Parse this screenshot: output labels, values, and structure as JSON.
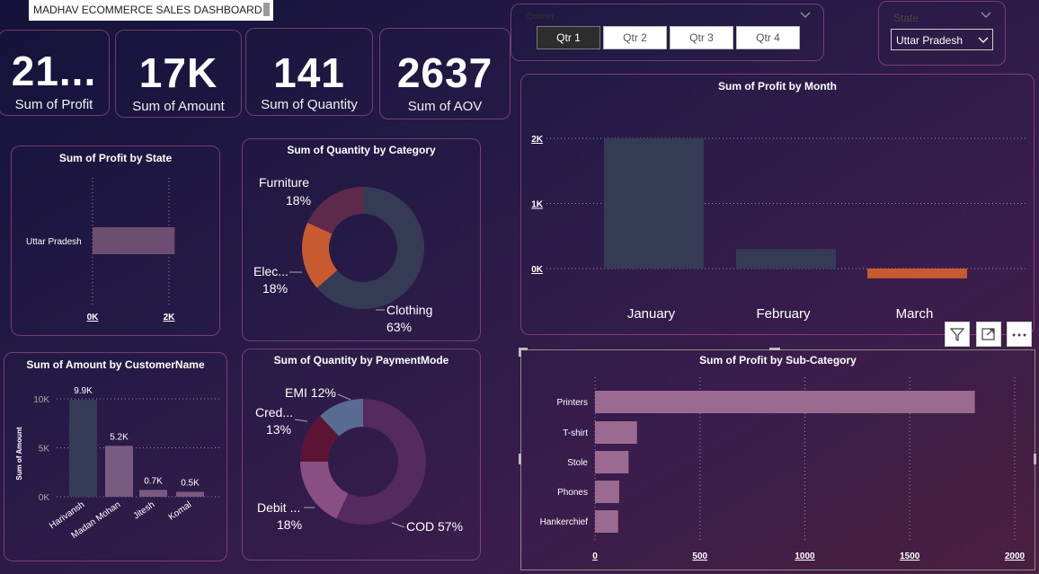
{
  "dashboard_title": "MADHAV ECOMMERCE SALES DASHBOARD",
  "kpis": [
    {
      "value": "21...",
      "label": "Sum of Profit"
    },
    {
      "value": "17K",
      "label": "Sum of Amount"
    },
    {
      "value": "141",
      "label": "Sum of Quantity"
    },
    {
      "value": "2637",
      "label": "Sum of AOV"
    }
  ],
  "quarter_filter": {
    "label": "Quarter",
    "options": [
      "Qtr 1",
      "Qtr 2",
      "Qtr 3",
      "Qtr 4"
    ],
    "selected": "Qtr 1"
  },
  "state_filter": {
    "label": "State",
    "selected": "Uttar Pradesh"
  },
  "visual_header_icons": [
    "filter-icon",
    "focus-mode-icon",
    "more-options-icon"
  ],
  "colors": {
    "dark_slate": "#353b55",
    "mauve": "#7a4f78",
    "orange": "#c85a30",
    "pink": "#a8698f",
    "card_border": "#b85aa0"
  },
  "chart_data": [
    {
      "type": "bar",
      "title": "Sum of Profit by State",
      "orientation": "horizontal",
      "categories": [
        "Uttar Pradesh"
      ],
      "values": [
        2150
      ],
      "xlim": [
        0,
        2000
      ],
      "x_ticks": [
        "0K",
        "2K"
      ],
      "grid": true
    },
    {
      "type": "pie",
      "donut": true,
      "title": "Sum of Quantity by Category",
      "slices": [
        {
          "label": "Clothing",
          "pct": "63%",
          "value": 63,
          "color": "#353b55"
        },
        {
          "label": "Elec...",
          "pct": "18%",
          "value": 18,
          "color": "#c85a30"
        },
        {
          "label": "Furniture",
          "pct": "18%",
          "value": 18,
          "color": "#5e2a4c"
        }
      ]
    },
    {
      "type": "bar",
      "title": "Sum of Amount by CustomerName",
      "ylabel": "Sum of Amount",
      "categories": [
        "Harivansh",
        "Madan Mohan",
        "Jitesh",
        "Komal"
      ],
      "values": [
        9900,
        5200,
        700,
        500
      ],
      "data_labels": [
        "9.9K",
        "5.2K",
        "0.7K",
        "0.5K"
      ],
      "colors": [
        "#353b55",
        "#7a5a80",
        "#7a5a80",
        "#7a5a80"
      ],
      "ylim": [
        0,
        10000
      ],
      "y_ticks": [
        "0K",
        "5K",
        "10K"
      ],
      "grid": true
    },
    {
      "type": "pie",
      "donut": true,
      "title": "Sum of Quantity by PaymentMode",
      "slices": [
        {
          "label": "COD",
          "pct": "57%",
          "value": 57,
          "color": "#552a5e"
        },
        {
          "label": "Debit ...",
          "pct": "18%",
          "value": 18,
          "color": "#8a4f82"
        },
        {
          "label": "Cred...",
          "pct": "13%",
          "value": 13,
          "color": "#5e1535"
        },
        {
          "label": "EMI",
          "pct": "12%",
          "value": 12,
          "color": "#5a6b92"
        }
      ]
    },
    {
      "type": "bar",
      "title": "Sum of Profit by Month",
      "categories": [
        "January",
        "February",
        "March"
      ],
      "values": [
        2000,
        300,
        -150
      ],
      "colors": [
        "#353b55",
        "#353b55",
        "#c85a30"
      ],
      "ylim": [
        -300,
        2300
      ],
      "y_ticks": [
        "0K",
        "1K",
        "2K"
      ],
      "grid": true
    },
    {
      "type": "bar",
      "title": "Sum of Profit by Sub-Category",
      "orientation": "horizontal",
      "categories": [
        "Printers",
        "T-shirt",
        "Stole",
        "Phones",
        "Hankerchief"
      ],
      "values": [
        1810,
        200,
        160,
        115,
        110
      ],
      "xlim": [
        0,
        2000
      ],
      "x_ticks": [
        "0",
        "500",
        "1000",
        "1500",
        "2000"
      ],
      "grid": true
    }
  ]
}
